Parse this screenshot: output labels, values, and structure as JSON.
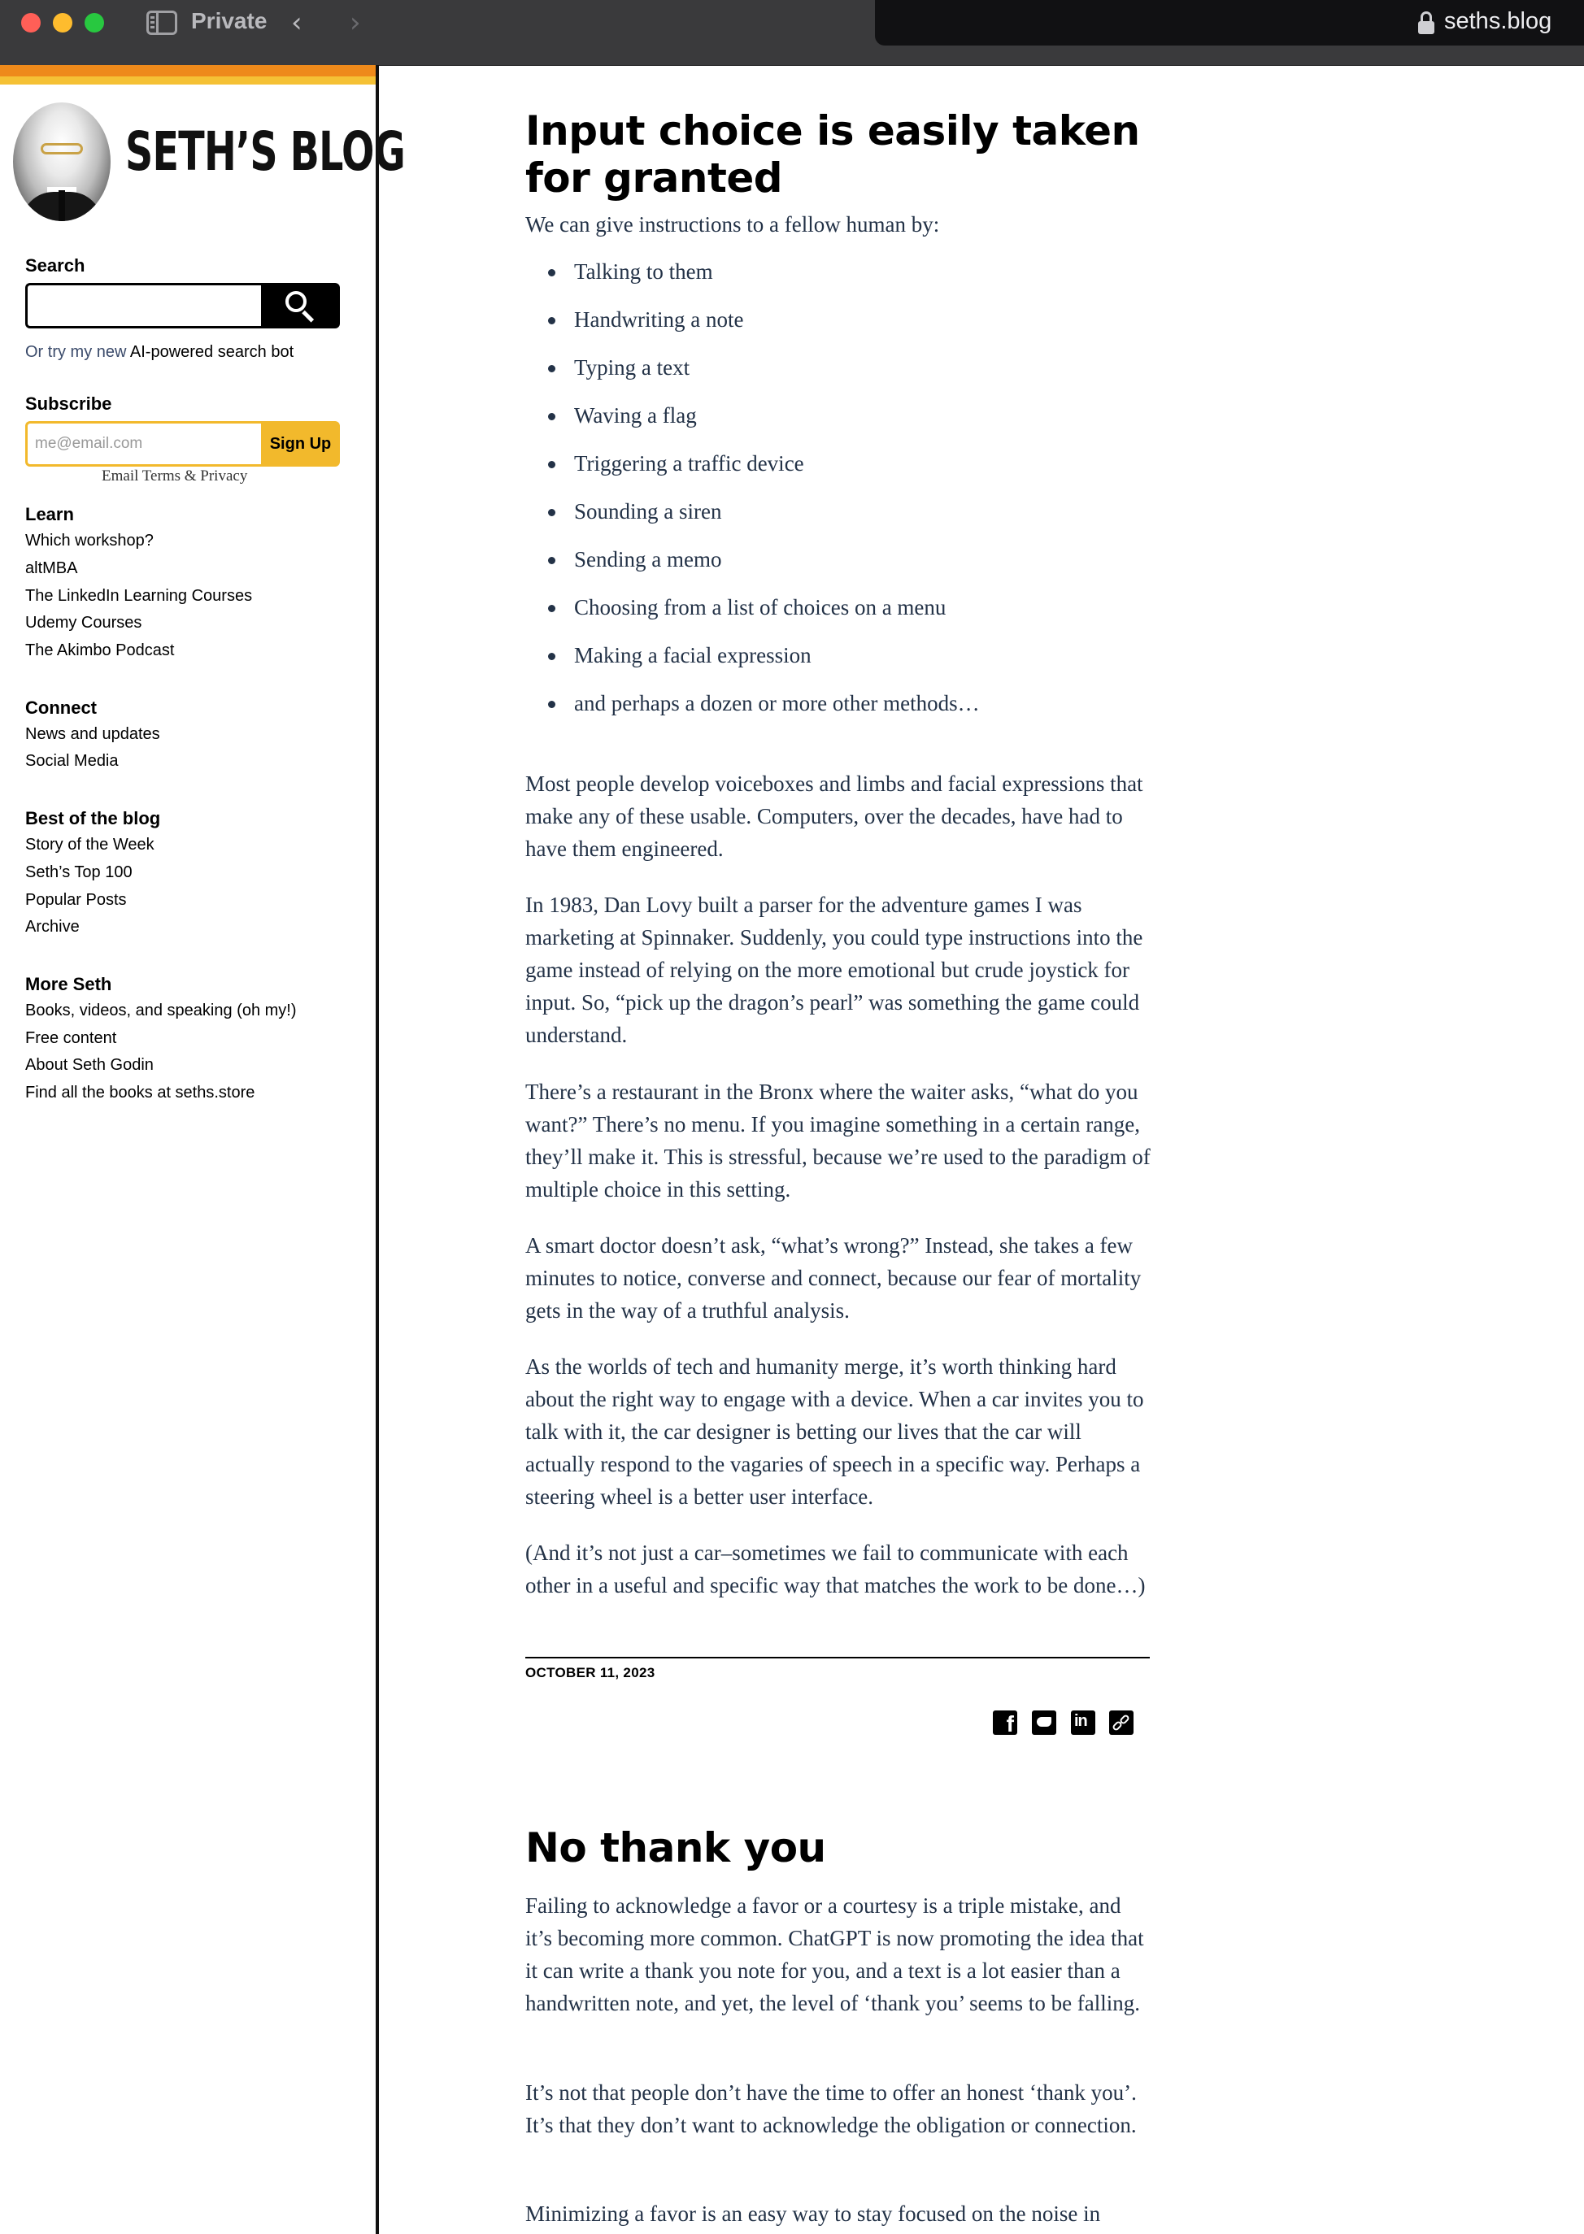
{
  "browser": {
    "mode_label": "Private",
    "url": "seths.blog"
  },
  "sidebar": {
    "site_title": "SETH’S BLOG",
    "search": {
      "heading": "Search",
      "placeholder": "",
      "ai_prefix": "Or try my new ",
      "ai_link": "AI-powered search bot"
    },
    "subscribe": {
      "heading": "Subscribe",
      "email_placeholder": "me@email.com",
      "button": "Sign Up",
      "terms": "Email Terms & Privacy"
    },
    "sections": [
      {
        "heading": "Learn",
        "links": [
          "Which workshop?",
          "altMBA",
          "The LinkedIn Learning Courses",
          "Udemy Courses",
          "The Akimbo Podcast"
        ]
      },
      {
        "heading": "Connect",
        "links": [
          "News and updates",
          "Social Media"
        ]
      },
      {
        "heading": "Best of the blog",
        "links": [
          "Story of the Week",
          "Seth’s Top 100",
          "Popular Posts",
          "Archive"
        ]
      },
      {
        "heading": "More Seth",
        "links": [
          "Books, videos, and speaking (oh my!)",
          "Free content",
          "About Seth Godin",
          "Find all the books at seths.store"
        ]
      }
    ]
  },
  "posts": [
    {
      "title": "Input choice is easily taken for granted",
      "intro": "We can give instructions to a fellow human by:",
      "bullets": [
        "Talking to them",
        "Handwriting a note",
        "Typing a text",
        "Waving a flag",
        "Triggering a traffic device",
        "Sounding a siren",
        "Sending a memo",
        "Choosing from a list of choices on a menu",
        "Making a facial expression",
        "and perhaps a dozen or more other methods…"
      ],
      "paragraphs": [
        "Most people develop voiceboxes and limbs and facial expressions that make any of these usable. Computers, over the decades, have had to have them engineered.",
        "In 1983, Dan Lovy built a parser for the adventure games I was marketing at Spinnaker. Suddenly, you could type instructions into the game instead of relying on the more emotional but crude joystick for input. So, “pick up the dragon’s pearl” was something the game could understand.",
        "There’s a restaurant in the Bronx where the waiter asks, “what do you want?” There’s no menu. If you imagine something in a certain range, they’ll make it. This is stressful, because we’re used to the paradigm of multiple choice in this setting.",
        "A smart doctor doesn’t ask, “what’s wrong?” Instead, she takes a few minutes to notice, converse and connect, because our fear of mortality gets in the way of a truthful analysis.",
        "As the worlds of tech and humanity merge, it’s worth thinking hard about the right way to engage with a device. When a car invites you to talk with it, the car designer is betting our lives that the car will actually respond to the vagaries of speech in a specific way. Perhaps a steering wheel is a better user interface.",
        "(And it’s not just a car–sometimes we fail to communicate with each other in a useful and specific way that matches the work to be done…)"
      ],
      "date": "OCTOBER 11, 2023"
    },
    {
      "title": "No thank you",
      "paragraphs": [
        "Failing to acknowledge a favor or a courtesy is a triple mistake, and it’s becoming more common. ChatGPT is now promoting the idea that it can write a thank you note for you, and a text is a lot easier than a handwritten note, and yet, the level of ‘thank you’ seems to be falling.",
        "It’s not that people don’t have the time to offer an honest ‘thank you’. It’s that they don’t want to acknowledge the obligation or connection.",
        "Minimizing a favor is an easy way to stay focused on the noise in"
      ]
    }
  ],
  "share_icons": [
    "facebook-icon",
    "twitter-icon",
    "linkedin-icon",
    "copy-link-icon"
  ],
  "colors": {
    "accent_orange": "#ee8a1b",
    "accent_yellow": "#f5c135",
    "body_text": "#233247"
  }
}
